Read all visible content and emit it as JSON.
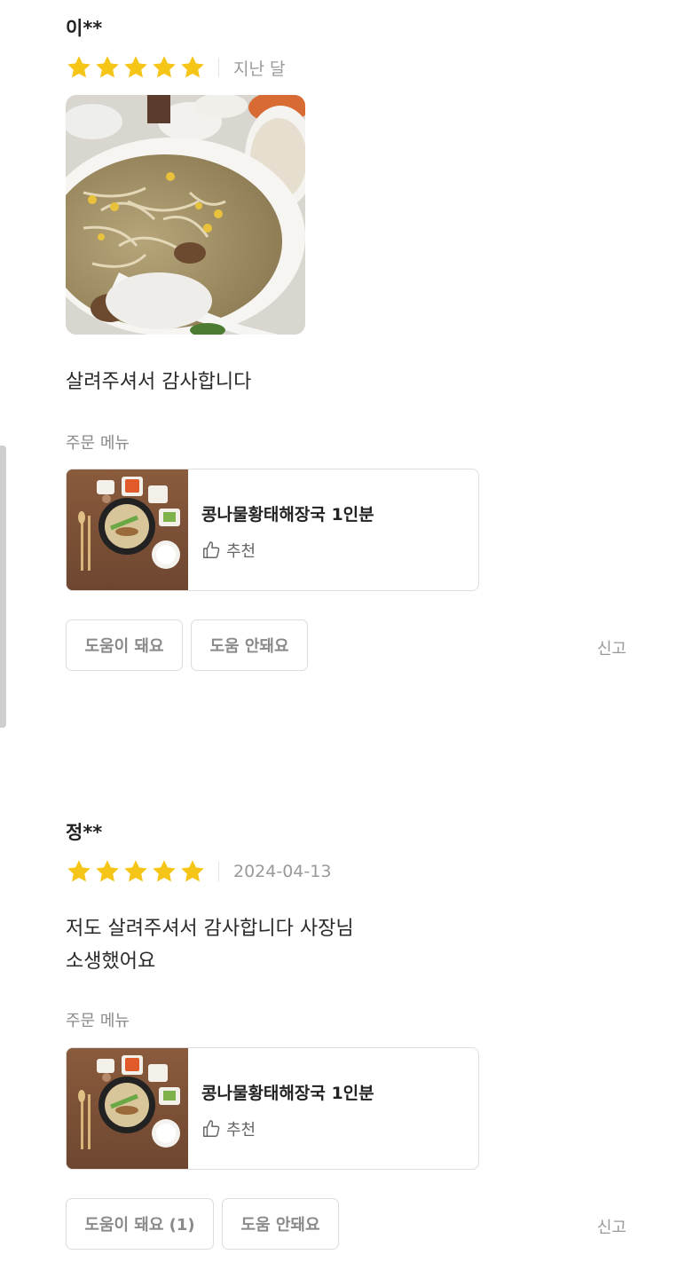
{
  "reviews": [
    {
      "reviewer": "이**",
      "rating": 5,
      "date": "지난 달",
      "text": "살려주셔서 감사합니다",
      "menu_label": "주문 메뉴",
      "menu_item": "콩나물황태해장국 1인분",
      "recommend": "추천",
      "helpful_label": "도움이 돼요",
      "not_helpful_label": "도움 안돼요",
      "report_label": "신고"
    },
    {
      "reviewer": "정**",
      "rating": 5,
      "date": "2024-04-13",
      "text_lines": [
        "저도 살려주셔서 감사합니다 사장님",
        "소생했어요"
      ],
      "menu_label": "주문 메뉴",
      "menu_item": "콩나물황태해장국 1인분",
      "recommend": "추천",
      "helpful_label": "도움이 돼요 (1)",
      "not_helpful_label": "도움 안돼요",
      "report_label": "신고"
    }
  ],
  "colors": {
    "star": "#F5C518",
    "border": "#dedede",
    "muted_text": "#8a8a8a"
  },
  "icons": {
    "rating": "star-icon",
    "recommend": "thumbs-up-icon"
  }
}
